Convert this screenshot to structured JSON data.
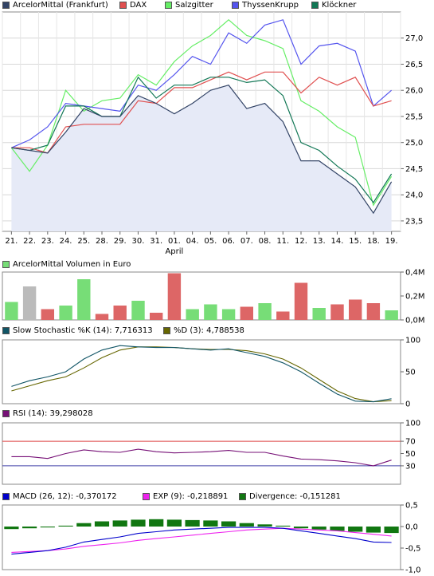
{
  "chart_data": [
    {
      "type": "line",
      "panel": "price",
      "x_labels": [
        "21.",
        "22.",
        "23.",
        "24.",
        "25.",
        "28.",
        "29.",
        "30.",
        "31.",
        "01.",
        "04.",
        "05.",
        "06.",
        "07.",
        "08.",
        "11.",
        "12.",
        "13.",
        "14.",
        "15.",
        "18.",
        "19."
      ],
      "month_label": "April",
      "y_ticks": [
        "23,5",
        "24,0",
        "24,5",
        "25,0",
        "25,5",
        "26,0",
        "26,5",
        "27,0"
      ],
      "ylim": [
        23.3,
        27.5
      ],
      "grid": true,
      "series": [
        {
          "name": "ArcelorMittal (Frankfurt)",
          "color": "#334466",
          "fill": "#e6eaf7",
          "values": [
            24.9,
            24.85,
            24.8,
            25.2,
            25.65,
            25.5,
            25.5,
            25.9,
            25.75,
            25.55,
            25.75,
            26.0,
            26.1,
            25.65,
            25.75,
            25.4,
            24.65,
            24.65,
            24.4,
            24.15,
            23.65,
            24.25
          ]
        },
        {
          "name": "DAX",
          "color": "#e05050",
          "values": [
            24.9,
            24.9,
            24.8,
            25.3,
            25.35,
            25.35,
            25.35,
            25.8,
            25.75,
            26.05,
            26.05,
            26.2,
            26.35,
            26.2,
            26.35,
            26.35,
            25.95,
            26.25,
            26.1,
            26.25,
            25.7,
            25.8
          ]
        },
        {
          "name": "Salzgitter",
          "color": "#66ee66",
          "values": [
            24.9,
            24.45,
            24.95,
            26.0,
            25.6,
            25.8,
            25.85,
            26.3,
            26.1,
            26.55,
            26.85,
            27.05,
            27.35,
            27.05,
            26.95,
            26.8,
            25.8,
            25.6,
            25.3,
            25.1,
            23.8,
            24.35
          ]
        },
        {
          "name": "ThyssenKrupp",
          "color": "#5555ee",
          "values": [
            24.9,
            25.05,
            25.3,
            25.75,
            25.7,
            25.65,
            25.6,
            26.1,
            26.0,
            26.3,
            26.65,
            26.5,
            27.1,
            26.9,
            27.25,
            27.35,
            26.5,
            26.85,
            26.9,
            26.75,
            25.7,
            26.0
          ]
        },
        {
          "name": "Klöckner",
          "color": "#117755",
          "values": [
            24.9,
            24.85,
            24.95,
            25.7,
            25.7,
            25.5,
            25.5,
            26.25,
            25.85,
            26.1,
            26.1,
            26.25,
            26.25,
            26.15,
            26.2,
            25.9,
            25.0,
            24.85,
            24.55,
            24.3,
            23.85,
            24.4
          ]
        }
      ]
    },
    {
      "type": "bar",
      "panel": "volume",
      "title": "ArcelorMittal Volumen in Euro",
      "legend_color": "#77dd77",
      "y_ticks": [
        "0,0M",
        "0,2M",
        "0,4M"
      ],
      "ylim": [
        0,
        0.4
      ],
      "values": [
        0.15,
        0.28,
        0.09,
        0.12,
        0.34,
        0.05,
        0.12,
        0.16,
        0.06,
        0.39,
        0.09,
        0.13,
        0.09,
        0.11,
        0.14,
        0.07,
        0.31,
        0.1,
        0.13,
        0.17,
        0.14,
        0.08
      ],
      "colors": [
        "#77dd77",
        "#bbbbbb",
        "#dd6666",
        "#77dd77",
        "#77dd77",
        "#dd6666",
        "#dd6666",
        "#77dd77",
        "#dd6666",
        "#dd6666",
        "#77dd77",
        "#77dd77",
        "#77dd77",
        "#dd6666",
        "#77dd77",
        "#dd6666",
        "#dd6666",
        "#77dd77",
        "#dd6666",
        "#dd6666",
        "#dd6666",
        "#77dd77"
      ]
    },
    {
      "type": "line",
      "panel": "stochastic",
      "y_ticks": [
        "0",
        "50",
        "100"
      ],
      "ylim": [
        0,
        100
      ],
      "series": [
        {
          "name": "Slow Stochastic %K (14): 7,716313",
          "color": "#115566",
          "values": [
            27,
            36,
            42,
            50,
            70,
            84,
            91,
            89,
            88,
            88,
            86,
            84,
            86,
            80,
            74,
            64,
            50,
            32,
            15,
            4,
            3,
            7.7
          ]
        },
        {
          "name": "%D (3): 4,788538",
          "color": "#666600",
          "values": [
            20,
            28,
            36,
            42,
            56,
            72,
            84,
            89,
            89,
            88,
            86,
            85,
            85,
            83,
            78,
            70,
            56,
            38,
            20,
            8,
            3,
            4.8
          ]
        }
      ]
    },
    {
      "type": "line",
      "panel": "rsi",
      "y_ticks": [
        "30",
        "50",
        "70",
        "100"
      ],
      "ylim": [
        0,
        100
      ],
      "ref_lines": [
        {
          "value": 70,
          "color": "#dd4444"
        },
        {
          "value": 30,
          "color": "#4444aa"
        }
      ],
      "series": [
        {
          "name": "RSI (14): 39,298028",
          "color": "#771177",
          "values": [
            45,
            45,
            42,
            50,
            56,
            53,
            52,
            57,
            53,
            51,
            52,
            53,
            55,
            52,
            52,
            46,
            41,
            40,
            38,
            35,
            30,
            39.3
          ]
        }
      ]
    },
    {
      "type": "bar",
      "panel": "macd",
      "y_ticks": [
        "-1,0",
        "-0,5",
        "0,0",
        "0,5"
      ],
      "ylim": [
        -1.0,
        0.5
      ],
      "series": [
        {
          "name": "MACD (26, 12): -0,370172",
          "color": "#0000cc",
          "values": [
            -0.64,
            -0.6,
            -0.56,
            -0.48,
            -0.36,
            -0.3,
            -0.24,
            -0.16,
            -0.12,
            -0.08,
            -0.06,
            -0.04,
            -0.02,
            -0.02,
            -0.02,
            -0.04,
            -0.1,
            -0.16,
            -0.22,
            -0.28,
            -0.36,
            -0.37
          ]
        },
        {
          "name": "EXP (9): -0,218891",
          "color": "#ee22ee",
          "values": [
            -0.6,
            -0.58,
            -0.56,
            -0.52,
            -0.46,
            -0.42,
            -0.38,
            -0.32,
            -0.28,
            -0.24,
            -0.2,
            -0.16,
            -0.12,
            -0.08,
            -0.06,
            -0.04,
            -0.06,
            -0.08,
            -0.1,
            -0.14,
            -0.18,
            -0.22
          ]
        },
        {
          "name": "Divergence: -0,151281",
          "color": "#117711",
          "values": [
            -0.06,
            -0.04,
            -0.02,
            0.02,
            0.08,
            0.12,
            0.14,
            0.16,
            0.17,
            0.16,
            0.15,
            0.14,
            0.12,
            0.08,
            0.05,
            0.02,
            -0.04,
            -0.07,
            -0.1,
            -0.12,
            -0.14,
            -0.15
          ]
        }
      ]
    }
  ]
}
